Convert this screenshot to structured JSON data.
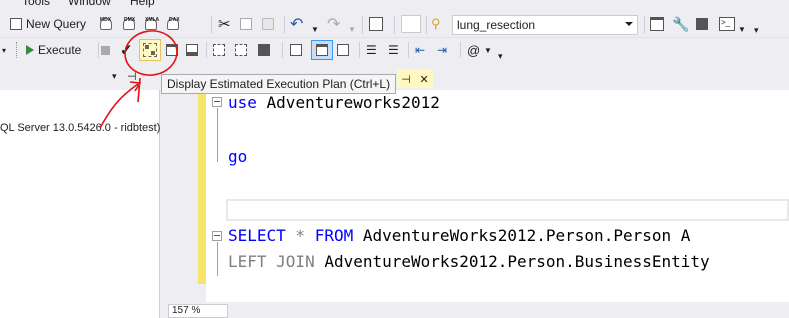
{
  "menu": {
    "tools": "Tools",
    "window": "Window",
    "help": "Help"
  },
  "toolbar1": {
    "new_query": "New Query",
    "mini_labels": [
      "MDX",
      "DMX",
      "XMLA",
      "DAX"
    ],
    "database": "lung_resection"
  },
  "toolbar2": {
    "execute": "Execute",
    "check": "✓"
  },
  "tooltip": "Display Estimated Execution Plan (Ctrl+L)",
  "object_explorer": {
    "server_node": "QL Server 13.0.5426.0 - ridbtest)"
  },
  "tab": {
    "pin": "⊣",
    "close": "✕"
  },
  "editor": {
    "lines": [
      {
        "kw": "use",
        "rest": " Adventureworks2012"
      },
      {
        "kw": "go",
        "rest": ""
      },
      {
        "kw": "SELECT",
        "star": " * ",
        "kw2": "FROM",
        "rest": " AdventureWorks2012.Person.Person A"
      },
      {
        "kw": "LEFT JOIN",
        "rest": " AdventureWorks2012.Person.BusinessEntity"
      }
    ]
  },
  "zoom": "157 %",
  "colors": {
    "annotation_red": "#e0141a",
    "keyword_blue": "#0000ff",
    "execute_green": "#388a34"
  }
}
